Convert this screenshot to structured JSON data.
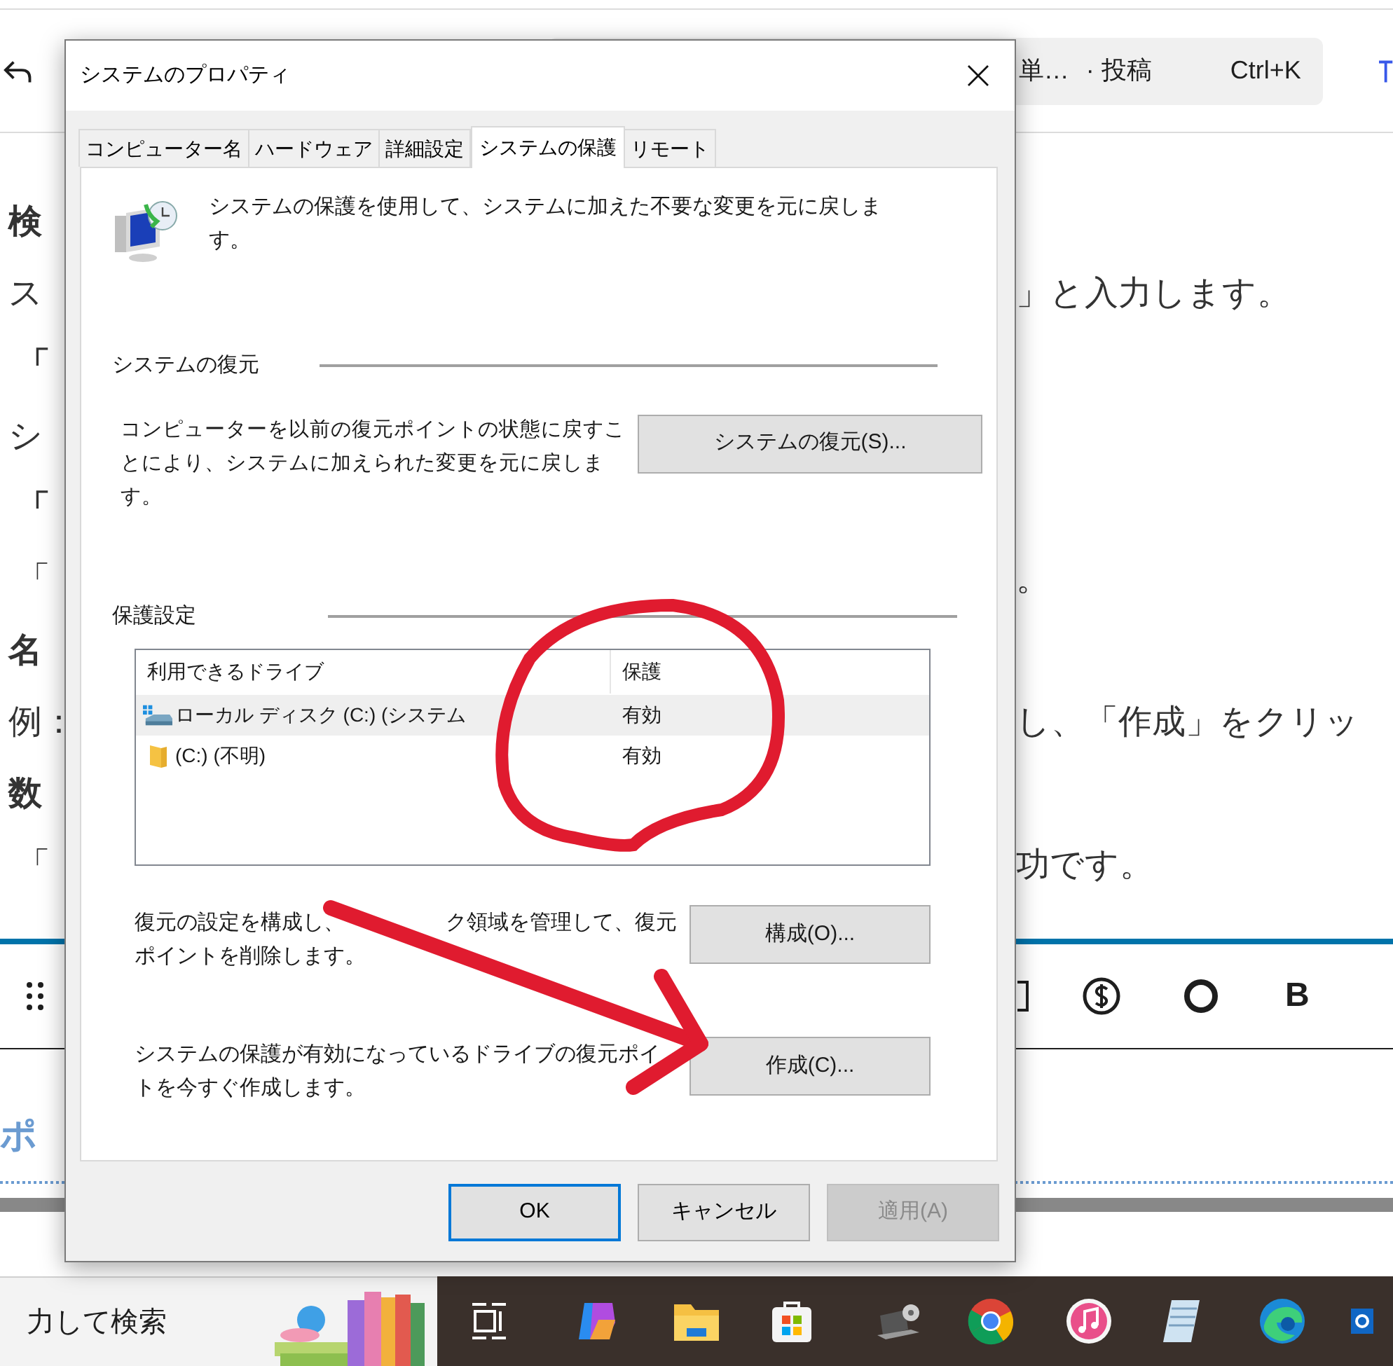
{
  "header": {
    "search_text": "単…",
    "post_label": "· 投稿",
    "shortcut": "Ctrl+K"
  },
  "article_rows": [
    {
      "kind": "heading",
      "left": "検"
    },
    {
      "kind": "body",
      "left": "ス",
      "right": "」と入力します。"
    },
    {
      "kind": "quote_heading",
      "left": "「"
    },
    {
      "kind": "body",
      "left": "シ"
    },
    {
      "kind": "quote_heading",
      "left": "「"
    },
    {
      "kind": "quote",
      "left": "「",
      "right": "。"
    },
    {
      "kind": "heading",
      "left": "名"
    },
    {
      "kind": "body",
      "left": "例：",
      "right": "し、「作成」をクリッ"
    },
    {
      "kind": "heading",
      "left": "数"
    },
    {
      "kind": "quote",
      "left": "「",
      "right": "功です。"
    }
  ],
  "editor_toolbar": {
    "bold_label": "B"
  },
  "section_heading": "ポ",
  "taskbar": {
    "search_placeholder": "力して検索"
  },
  "dialog": {
    "title": "システムのプロパティ",
    "tabs": [
      {
        "label": "コンピューター名",
        "selected": false
      },
      {
        "label": "ハードウェア",
        "selected": false
      },
      {
        "label": "詳細設定",
        "selected": false
      },
      {
        "label": "システムの保護",
        "selected": true
      },
      {
        "label": "リモート",
        "selected": false
      }
    ],
    "intro": "システムの保護を使用して、システムに加えた不要な変更を元に戻します。",
    "restore_group": {
      "title": "システムの復元",
      "description": "コンピューターを以前の復元ポイントの状態に戻すことにより、システムに加えられた変更を元に戻します。",
      "button": "システムの復元(S)..."
    },
    "protection_group": {
      "title": "保護設定",
      "columns": [
        "利用できるドライブ",
        "保護"
      ],
      "drives": [
        {
          "kind": "system",
          "name": "ローカル ディスク (C:) (システム",
          "protection": "有効",
          "selected": true
        },
        {
          "kind": "folder",
          "name": "(C:) (不明)",
          "protection": "有効",
          "selected": false
        }
      ],
      "configure": {
        "description_parts": [
          "復元の設定を構成し、",
          "ク領域を管理して、復元",
          "ポイントを削除します。"
        ],
        "button": "構成(O)..."
      },
      "create": {
        "description_parts": [
          "システムの保護が有効になっているドライブの復元ポイ",
          "トを今すぐ作成します。"
        ],
        "button": "作成(C)..."
      }
    },
    "buttons": [
      {
        "label": "OK",
        "kind": "default"
      },
      {
        "label": "キャンセル",
        "kind": "normal"
      },
      {
        "label": "適用(A)",
        "kind": "disabled"
      }
    ]
  }
}
